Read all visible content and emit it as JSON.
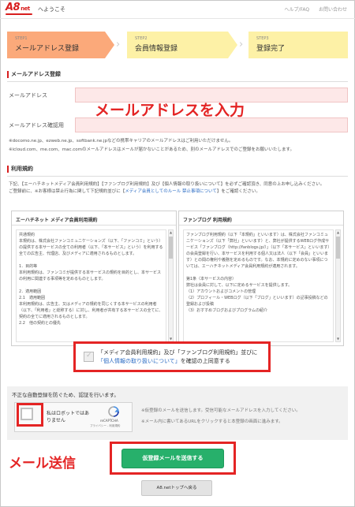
{
  "header": {
    "logo_main": "A8",
    "logo_sub": "net",
    "welcome": "へようこそ",
    "links": [
      "ヘルプ/FAQ",
      "お問い合わせ"
    ]
  },
  "steps": [
    {
      "no": "STEP1",
      "label": "メールアドレス登録"
    },
    {
      "no": "STEP2",
      "label": "会員情報登録"
    },
    {
      "no": "STEP3",
      "label": "登録完了"
    }
  ],
  "email_section": {
    "heading": "メールアドレス登録",
    "email_label": "メールアドレス",
    "email_value": "",
    "confirm_label": "メールアドレス確認用",
    "confirm_value": "",
    "overlay": "メールアドレスを入力",
    "note_line1": "※docomo.ne.jp、ezweb.ne.jp、softbank.ne.jpなどの携帯キャリアのメールアドレスはご利用いただけません。",
    "note_line2": "※icloud.com、me.com、mac.comのメールアドレスはメールが届かないことがあるため、別のメールアドレスでのご登録をお願いいたします。"
  },
  "terms_section": {
    "heading": "利用規約",
    "intro_a": "下記、【エーハチネットメディア会員利用規約】【ファンブログ利用規約】及び【個人情報の取り扱いについて】を必ずご確認頂き、同意の上お申し込みください。",
    "intro_b": "ご登録前に、※お客様は禁止行為に関して下記規約並びに【",
    "intro_link": "メディア会員としてのルール 禁止事項について",
    "intro_c": "】をご確認ください。",
    "box1_title": "エーハチネット メディア会員利用規約",
    "box1_text": "共通規約\n本規約は、株式会社ファンコミュニケーションズ（以下、「ファンコミ」という）の提供する本サービスの全ての利用者（以下、「本サービス」という）を利用する全ての広告主、代理店、及びメディアに適用されるものとします。\n\n1．目的等\n本利用規約は、ファンコミが提供する本サービスの規約を目的とし、本サービスの利用に関連する事項等を定めるものとします。\n\n2．適用範囲\n2.1　適用範囲\n本利用規約は、広告主、又はメディアの規約を同じくする本サービスの利用者（以下、「利用者」と総称する）に対し、利用者が共有する本サービスの全てに、契約の全てに適用されるものとします。\n2.2　他の契約との優先",
    "box2_title": "ファンブログ 利用規約",
    "box2_text": "ファンブログ利用規約（以下「本規約」といいます）は、株式会社ファンコミュニケーションズ（以下「弊社」といいます）と、弊社が提供するWEBログ作成サービス「ファンブログ（http://fanblogs.jp/）」（以下「本サービス」といいます）の会員登録を行い、本サービスを利用する個人又は法人（以下「会員」といいます）との間の権利や義務を定めるものです。なお、本規約に定めのない事項については、エーハチネットメディア会員利用規約が適用されます。\n\n第1条（本サービスの内容）\n弊社は会員に対して、以下に定めるサービスを提供します。\n（1）アカウントおよびコメントの管理\n（2）プロフィール・WEBログ（以下「ブログ」といいます）の記事投稿などの登録および投稿\n（3）おすすめブログおよびプログラムの紹介",
    "agree_a": "「メディア会員利用規約」及び「ファンブログ利用規約」並びに",
    "agree_link": "「個人情報の取り扱いについて」",
    "agree_b": "を確認の上同意する"
  },
  "captcha_section": {
    "title": "不正な自動登録を防ぐため、認証を行います。",
    "checkbox_label": "私はロボットではありません",
    "brand": "reCAPTCHA",
    "links": "プライバシー - 利用規約",
    "note1": "※仮登録のメールを送信します。受信可能なメールアドレスを入力してください。",
    "note2": "※メール内に書いてあるURLをクリックすると本登録の画面に進みます。"
  },
  "actions": {
    "submit_overlay": "メール送信",
    "submit_label": "仮登録メールを送信する",
    "back_label": "A8.netトップへ戻る"
  },
  "colors": {
    "annotation_red": "#e42424",
    "brand_red": "#d81e1e",
    "submit_green": "#27b06b",
    "step_active": "#fba97a",
    "step_inactive": "#fdf1a6",
    "input_bg": "#fde8e8"
  }
}
